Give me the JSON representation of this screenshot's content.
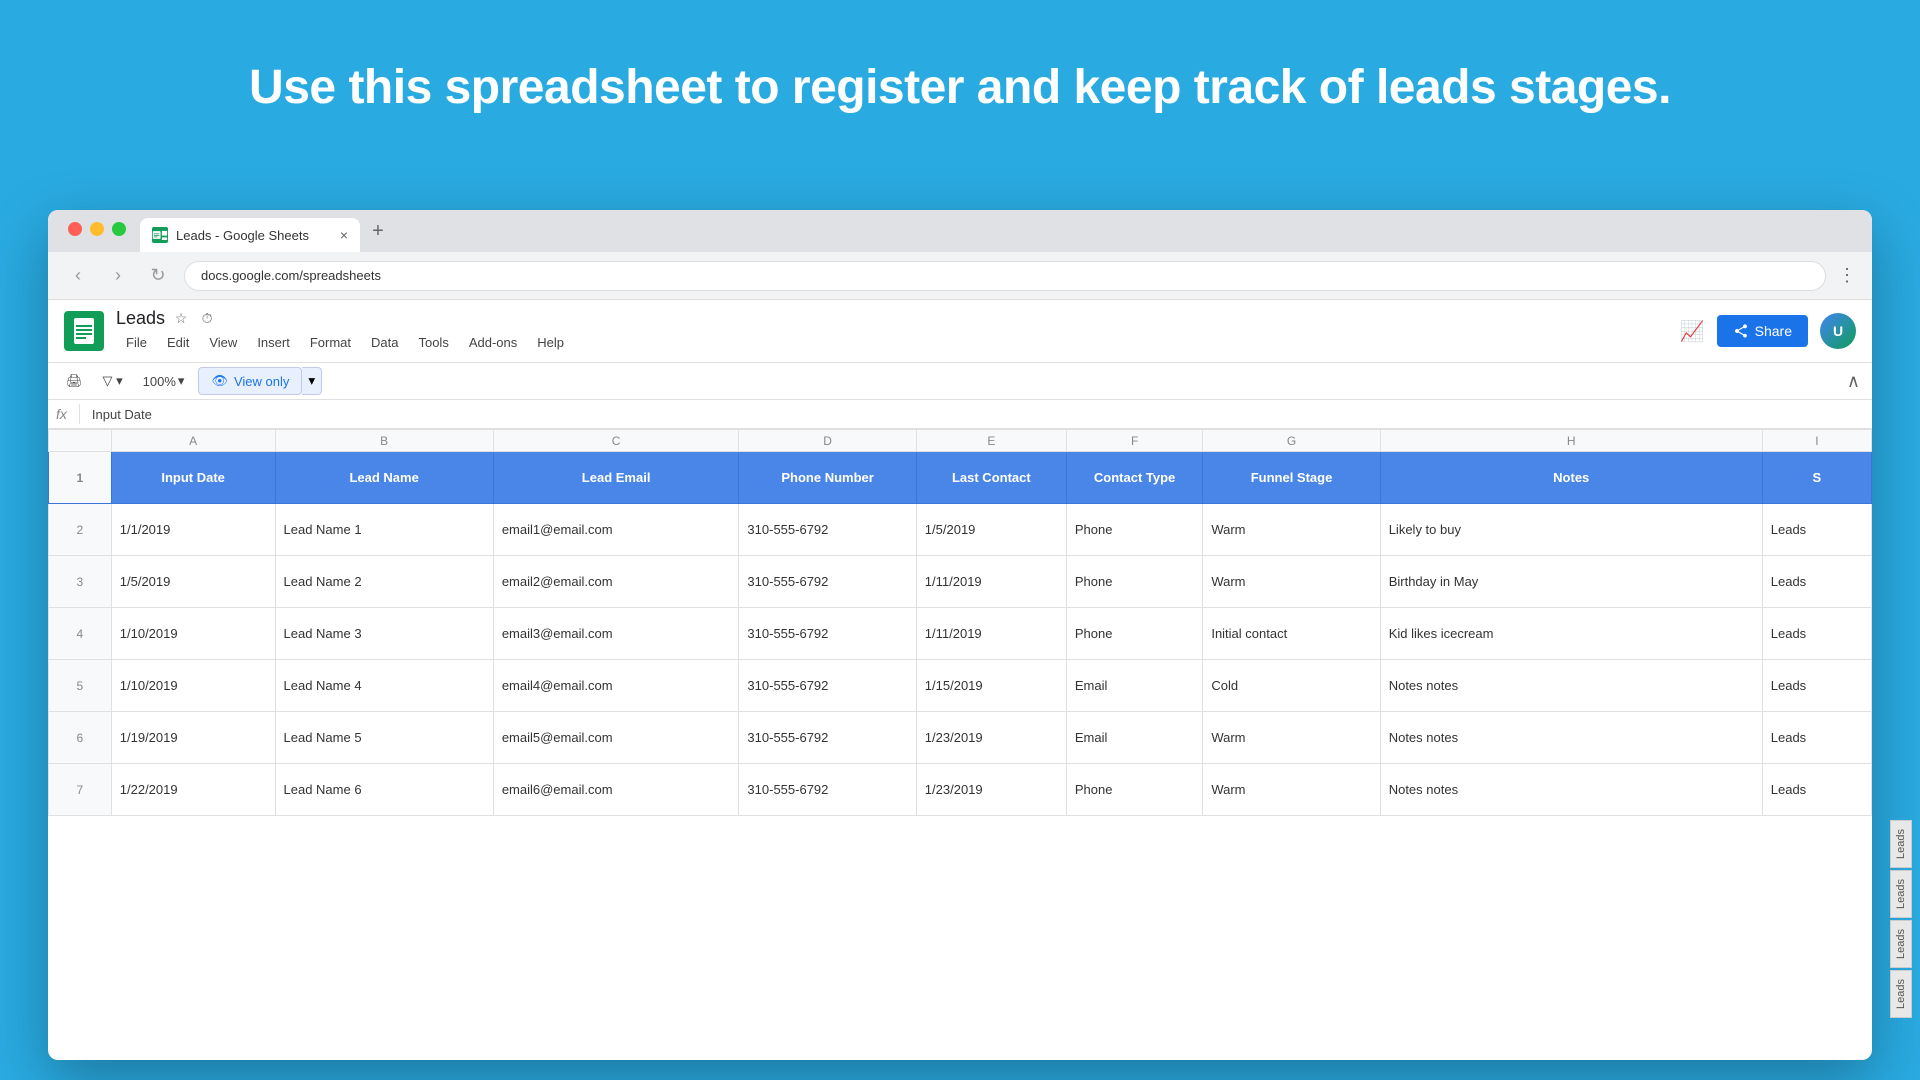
{
  "page": {
    "headline": "Use this spreadsheet to register and keep track of leads stages.",
    "background_color": "#29abe2"
  },
  "browser": {
    "tab_title": "Leads - Google Sheets",
    "tab_close": "×",
    "tab_new": "+",
    "nav_back": "‹",
    "nav_forward": "›",
    "nav_refresh": "↻",
    "menu_dots": "⋮"
  },
  "sheets": {
    "doc_name": "Leads",
    "star_icon": "☆",
    "history_icon": "⏱",
    "share_label": "Share",
    "menu_items": [
      "File",
      "Edit",
      "View",
      "Insert",
      "Format",
      "Data",
      "Tools",
      "Add-ons",
      "Help"
    ],
    "zoom_level": "100%",
    "view_only_label": "View only",
    "formula_bar_label": "fx",
    "formula_cell": "Input Date",
    "collapse_icon": "∧"
  },
  "spreadsheet": {
    "col_headers": [
      "A",
      "B",
      "C",
      "D",
      "E",
      "F",
      "G",
      "H",
      "I"
    ],
    "headers": [
      "Input Date",
      "Lead Name",
      "Lead Email",
      "Phone Number",
      "Last Contact",
      "Contact Type",
      "Funnel Stage",
      "Notes",
      "S"
    ],
    "rows": [
      {
        "row_num": "2",
        "input_date": "1/1/2019",
        "lead_name": "Lead Name 1",
        "lead_email": "email1@email.com",
        "phone": "310-555-6792",
        "last_contact": "1/5/2019",
        "contact_type": "Phone",
        "funnel_stage": "Warm",
        "notes": "Likely to buy",
        "tag": "Leads"
      },
      {
        "row_num": "3",
        "input_date": "1/5/2019",
        "lead_name": "Lead Name 2",
        "lead_email": "email2@email.com",
        "phone": "310-555-6792",
        "last_contact": "1/11/2019",
        "contact_type": "Phone",
        "funnel_stage": "Warm",
        "notes": "Birthday in May",
        "tag": "Leads"
      },
      {
        "row_num": "4",
        "input_date": "1/10/2019",
        "lead_name": "Lead Name 3",
        "lead_email": "email3@email.com",
        "phone": "310-555-6792",
        "last_contact": "1/11/2019",
        "contact_type": "Phone",
        "funnel_stage": "Initial contact",
        "notes": "Kid likes icecream",
        "tag": "Leads"
      },
      {
        "row_num": "5",
        "input_date": "1/10/2019",
        "lead_name": "Lead Name 4",
        "lead_email": "email4@email.com",
        "phone": "310-555-6792",
        "last_contact": "1/15/2019",
        "contact_type": "Email",
        "funnel_stage": "Cold",
        "notes": "Notes notes",
        "tag": "Leads"
      },
      {
        "row_num": "6",
        "input_date": "1/19/2019",
        "lead_name": "Lead Name 5",
        "lead_email": "email5@email.com",
        "phone": "310-555-6792",
        "last_contact": "1/23/2019",
        "contact_type": "Email",
        "funnel_stage": "Warm",
        "notes": "Notes notes",
        "tag": "Leads"
      },
      {
        "row_num": "7",
        "input_date": "1/22/2019",
        "lead_name": "Lead Name 6",
        "lead_email": "email6@email.com",
        "phone": "310-555-6792",
        "last_contact": "1/23/2019",
        "contact_type": "Phone",
        "funnel_stage": "Warm",
        "notes": "Notes notes",
        "tag": "Leads"
      }
    ],
    "sheet_tabs": [
      "Leads",
      "Leads",
      "Leads",
      "Leads"
    ]
  }
}
